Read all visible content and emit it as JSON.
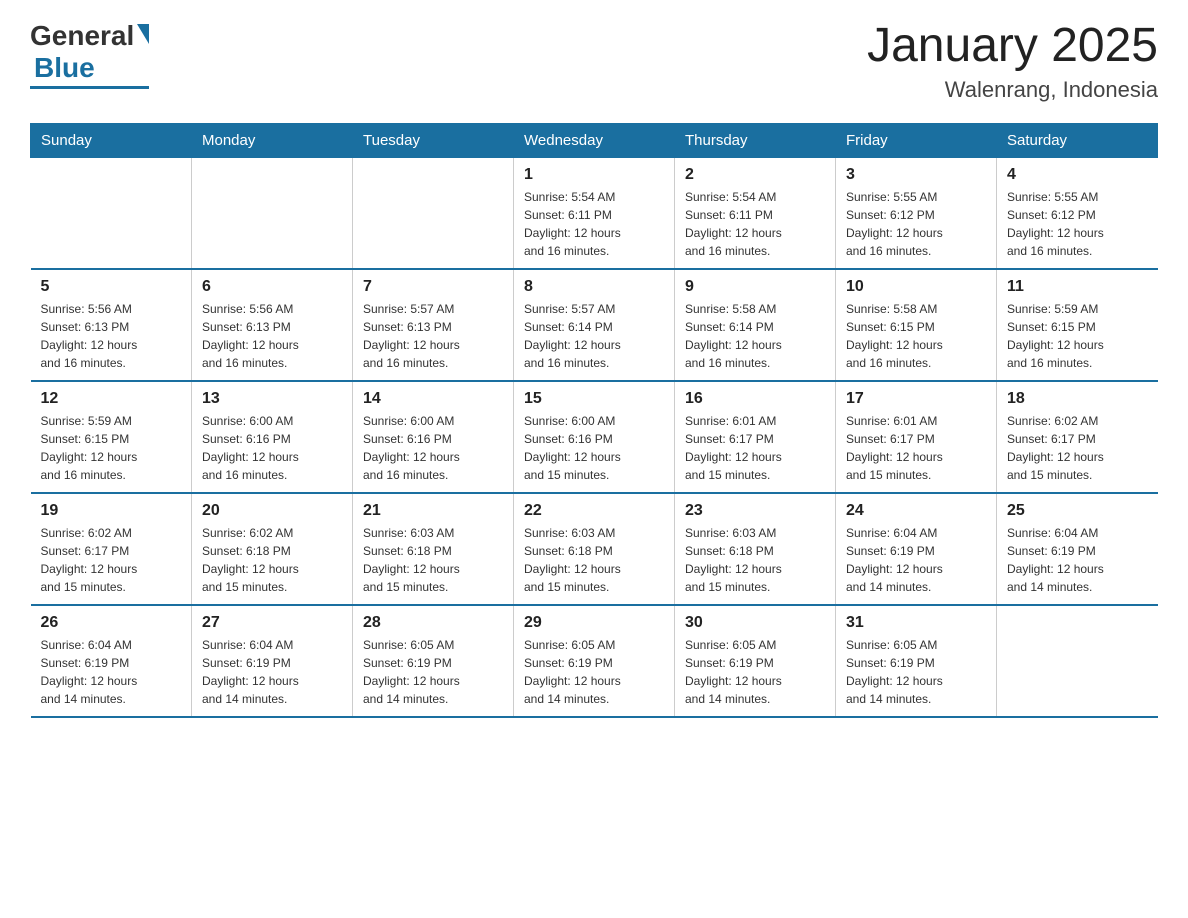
{
  "logo": {
    "general": "General",
    "blue": "Blue"
  },
  "title": "January 2025",
  "subtitle": "Walenrang, Indonesia",
  "days_header": [
    "Sunday",
    "Monday",
    "Tuesday",
    "Wednesday",
    "Thursday",
    "Friday",
    "Saturday"
  ],
  "weeks": [
    [
      {
        "day": "",
        "info": ""
      },
      {
        "day": "",
        "info": ""
      },
      {
        "day": "",
        "info": ""
      },
      {
        "day": "1",
        "info": "Sunrise: 5:54 AM\nSunset: 6:11 PM\nDaylight: 12 hours\nand 16 minutes."
      },
      {
        "day": "2",
        "info": "Sunrise: 5:54 AM\nSunset: 6:11 PM\nDaylight: 12 hours\nand 16 minutes."
      },
      {
        "day": "3",
        "info": "Sunrise: 5:55 AM\nSunset: 6:12 PM\nDaylight: 12 hours\nand 16 minutes."
      },
      {
        "day": "4",
        "info": "Sunrise: 5:55 AM\nSunset: 6:12 PM\nDaylight: 12 hours\nand 16 minutes."
      }
    ],
    [
      {
        "day": "5",
        "info": "Sunrise: 5:56 AM\nSunset: 6:13 PM\nDaylight: 12 hours\nand 16 minutes."
      },
      {
        "day": "6",
        "info": "Sunrise: 5:56 AM\nSunset: 6:13 PM\nDaylight: 12 hours\nand 16 minutes."
      },
      {
        "day": "7",
        "info": "Sunrise: 5:57 AM\nSunset: 6:13 PM\nDaylight: 12 hours\nand 16 minutes."
      },
      {
        "day": "8",
        "info": "Sunrise: 5:57 AM\nSunset: 6:14 PM\nDaylight: 12 hours\nand 16 minutes."
      },
      {
        "day": "9",
        "info": "Sunrise: 5:58 AM\nSunset: 6:14 PM\nDaylight: 12 hours\nand 16 minutes."
      },
      {
        "day": "10",
        "info": "Sunrise: 5:58 AM\nSunset: 6:15 PM\nDaylight: 12 hours\nand 16 minutes."
      },
      {
        "day": "11",
        "info": "Sunrise: 5:59 AM\nSunset: 6:15 PM\nDaylight: 12 hours\nand 16 minutes."
      }
    ],
    [
      {
        "day": "12",
        "info": "Sunrise: 5:59 AM\nSunset: 6:15 PM\nDaylight: 12 hours\nand 16 minutes."
      },
      {
        "day": "13",
        "info": "Sunrise: 6:00 AM\nSunset: 6:16 PM\nDaylight: 12 hours\nand 16 minutes."
      },
      {
        "day": "14",
        "info": "Sunrise: 6:00 AM\nSunset: 6:16 PM\nDaylight: 12 hours\nand 16 minutes."
      },
      {
        "day": "15",
        "info": "Sunrise: 6:00 AM\nSunset: 6:16 PM\nDaylight: 12 hours\nand 15 minutes."
      },
      {
        "day": "16",
        "info": "Sunrise: 6:01 AM\nSunset: 6:17 PM\nDaylight: 12 hours\nand 15 minutes."
      },
      {
        "day": "17",
        "info": "Sunrise: 6:01 AM\nSunset: 6:17 PM\nDaylight: 12 hours\nand 15 minutes."
      },
      {
        "day": "18",
        "info": "Sunrise: 6:02 AM\nSunset: 6:17 PM\nDaylight: 12 hours\nand 15 minutes."
      }
    ],
    [
      {
        "day": "19",
        "info": "Sunrise: 6:02 AM\nSunset: 6:17 PM\nDaylight: 12 hours\nand 15 minutes."
      },
      {
        "day": "20",
        "info": "Sunrise: 6:02 AM\nSunset: 6:18 PM\nDaylight: 12 hours\nand 15 minutes."
      },
      {
        "day": "21",
        "info": "Sunrise: 6:03 AM\nSunset: 6:18 PM\nDaylight: 12 hours\nand 15 minutes."
      },
      {
        "day": "22",
        "info": "Sunrise: 6:03 AM\nSunset: 6:18 PM\nDaylight: 12 hours\nand 15 minutes."
      },
      {
        "day": "23",
        "info": "Sunrise: 6:03 AM\nSunset: 6:18 PM\nDaylight: 12 hours\nand 15 minutes."
      },
      {
        "day": "24",
        "info": "Sunrise: 6:04 AM\nSunset: 6:19 PM\nDaylight: 12 hours\nand 14 minutes."
      },
      {
        "day": "25",
        "info": "Sunrise: 6:04 AM\nSunset: 6:19 PM\nDaylight: 12 hours\nand 14 minutes."
      }
    ],
    [
      {
        "day": "26",
        "info": "Sunrise: 6:04 AM\nSunset: 6:19 PM\nDaylight: 12 hours\nand 14 minutes."
      },
      {
        "day": "27",
        "info": "Sunrise: 6:04 AM\nSunset: 6:19 PM\nDaylight: 12 hours\nand 14 minutes."
      },
      {
        "day": "28",
        "info": "Sunrise: 6:05 AM\nSunset: 6:19 PM\nDaylight: 12 hours\nand 14 minutes."
      },
      {
        "day": "29",
        "info": "Sunrise: 6:05 AM\nSunset: 6:19 PM\nDaylight: 12 hours\nand 14 minutes."
      },
      {
        "day": "30",
        "info": "Sunrise: 6:05 AM\nSunset: 6:19 PM\nDaylight: 12 hours\nand 14 minutes."
      },
      {
        "day": "31",
        "info": "Sunrise: 6:05 AM\nSunset: 6:19 PM\nDaylight: 12 hours\nand 14 minutes."
      },
      {
        "day": "",
        "info": ""
      }
    ]
  ]
}
